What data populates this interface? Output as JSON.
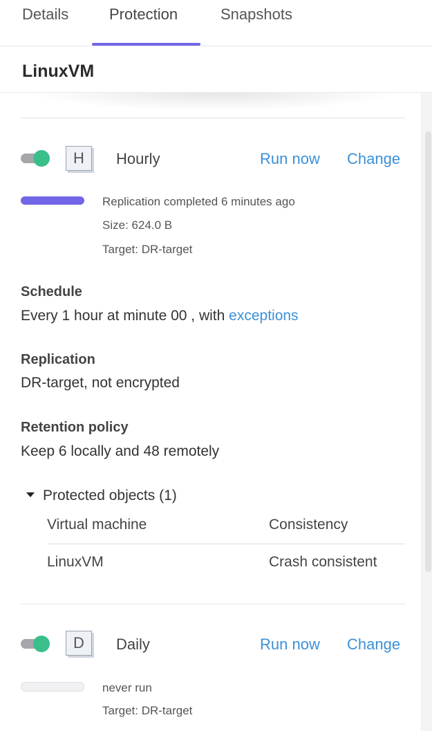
{
  "tabs": [
    {
      "label": "Details"
    },
    {
      "label": "Protection",
      "active": true
    },
    {
      "label": "Snapshots"
    }
  ],
  "header": {
    "title": "LinuxVM"
  },
  "hourly": {
    "badge": "H",
    "name": "Hourly",
    "enabled": true,
    "run_now": "Run now",
    "change": "Change",
    "status": "Replication completed 6 minutes ago",
    "size": "Size: 624.0 B",
    "target": "Target: DR-target",
    "progress": 1.0
  },
  "schedule": {
    "label": "Schedule",
    "text": "Every 1 hour at minute 00 , with ",
    "link": "exceptions"
  },
  "replication": {
    "label": "Replication",
    "text": "DR-target, not encrypted"
  },
  "retention": {
    "label": "Retention policy",
    "text": "Keep 6 locally and 48 remotely"
  },
  "protected_objects": {
    "title": "Protected objects (1)",
    "columns": [
      "Virtual machine",
      "Consistency"
    ],
    "rows": [
      [
        "LinuxVM",
        "Crash consistent"
      ]
    ]
  },
  "daily": {
    "badge": "D",
    "name": "Daily",
    "enabled": true,
    "run_now": "Run now",
    "change": "Change",
    "status": "never run",
    "target": "Target: DR-target",
    "progress": 0
  },
  "colors": {
    "accent": "#7166e6",
    "link": "#3b90d8",
    "toggle_on": "#3bbf8a"
  }
}
